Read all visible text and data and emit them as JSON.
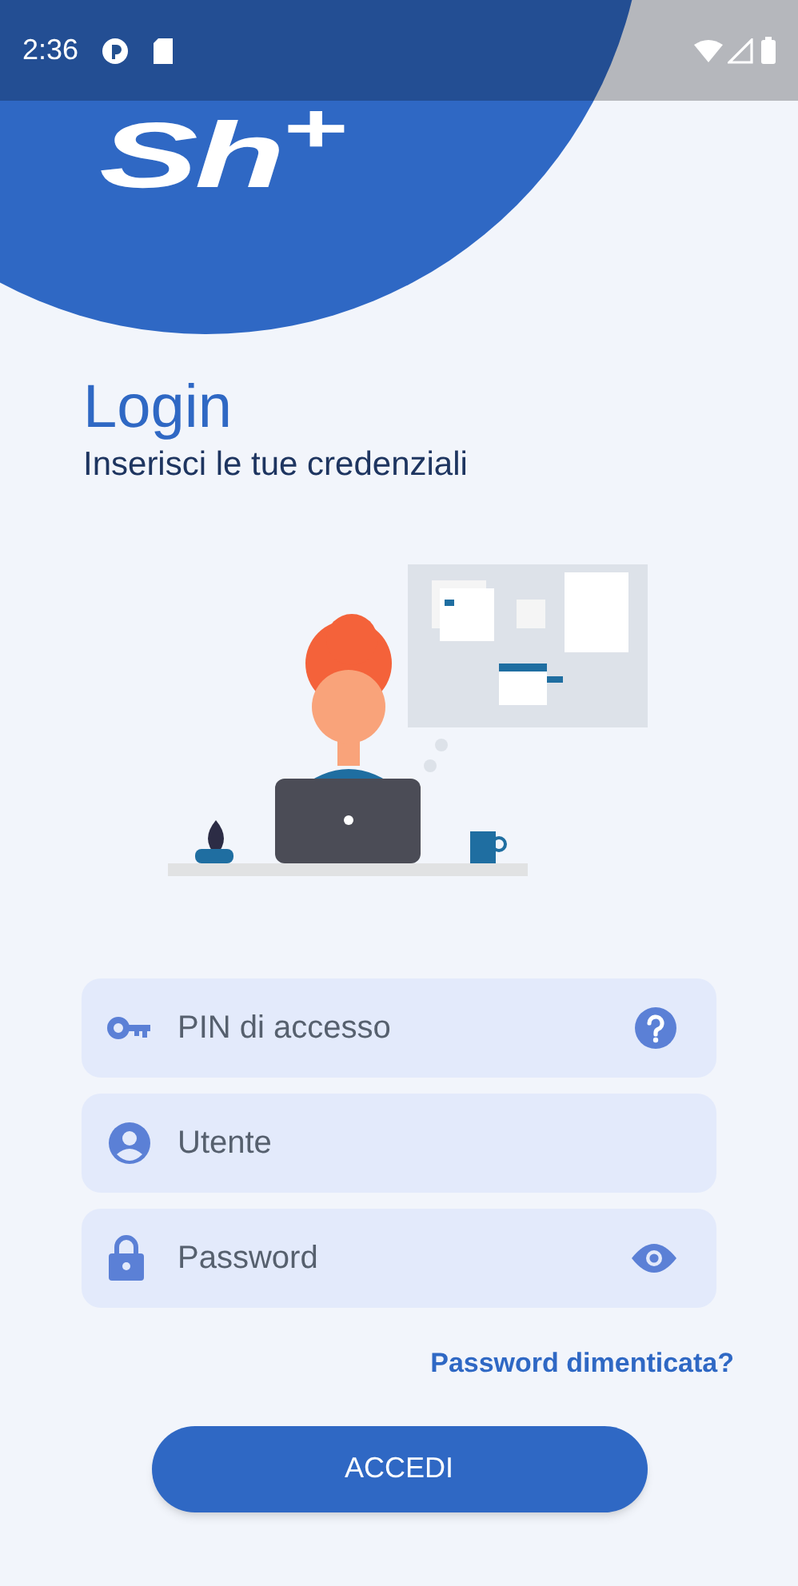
{
  "status_bar": {
    "time": "2:36"
  },
  "logo": {
    "text": "Sh$^{+}$"
  },
  "heading": {
    "title": "Login",
    "subtitle": "Inserisci le tue credenziali"
  },
  "fields": [
    {
      "kind": "pin",
      "placeholder": "PIN di accesso",
      "trailing": {
        "kind": "help"
      }
    },
    {
      "kind": "user",
      "placeholder": "Utente"
    },
    {
      "kind": "password",
      "placeholder": "Password",
      "trailing": {
        "kind": "reveal"
      }
    }
  ],
  "forgot_link": "Password dimenticata?",
  "submit_button": "ACCEDI"
}
